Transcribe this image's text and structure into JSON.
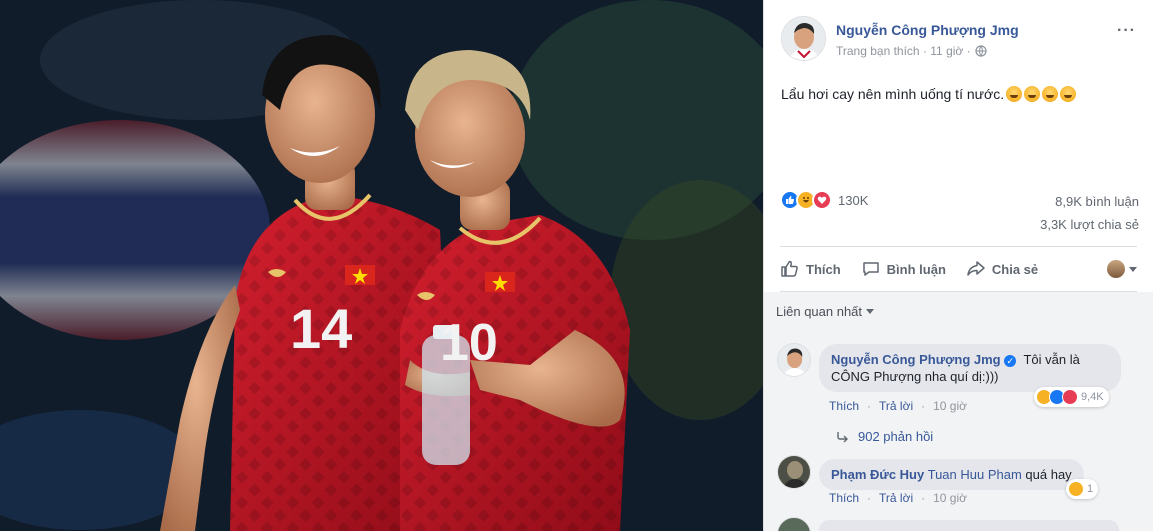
{
  "post": {
    "author": "Nguyễn Công Phượng Jmg",
    "meta_text": "Trang bạn thích · 11 giờ ·",
    "more": "···",
    "text": "Lẩu hơi cay nên mình uống tí nước.",
    "reaction_count": "130K",
    "comment_count": "8,9K bình luận",
    "share_count": "3,3K lượt chia sẻ"
  },
  "photo": {
    "jersey_left": "14",
    "jersey_right": "10"
  },
  "actions": {
    "like": "Thích",
    "comment": "Bình luận",
    "share": "Chia sẻ"
  },
  "comments": {
    "sort_label": "Liên quan nhất",
    "items": [
      {
        "name": "Nguyễn Công Phượng Jmg",
        "text_line1": "Tôi vẫn là",
        "text_line2": "CÔNG Phượng nha quí dị:)))",
        "reaction_count": "9,4K",
        "like": "Thích",
        "reply": "Trả lời",
        "time": "10 giờ",
        "replies_label": "902 phản hồi"
      },
      {
        "name": "Phạm Đức Huy",
        "tag": "Tuan Huu Pham",
        "text": "quá hay",
        "reaction_count": "1",
        "like": "Thích",
        "reply": "Trả lời",
        "time": "10 giờ"
      }
    ]
  },
  "colors": {
    "link_blue": "#385898",
    "like_blue": "#1877f2",
    "jersey_red": "#c8102e",
    "love_red": "#e83c54",
    "haha_yellow": "#f7b125"
  }
}
